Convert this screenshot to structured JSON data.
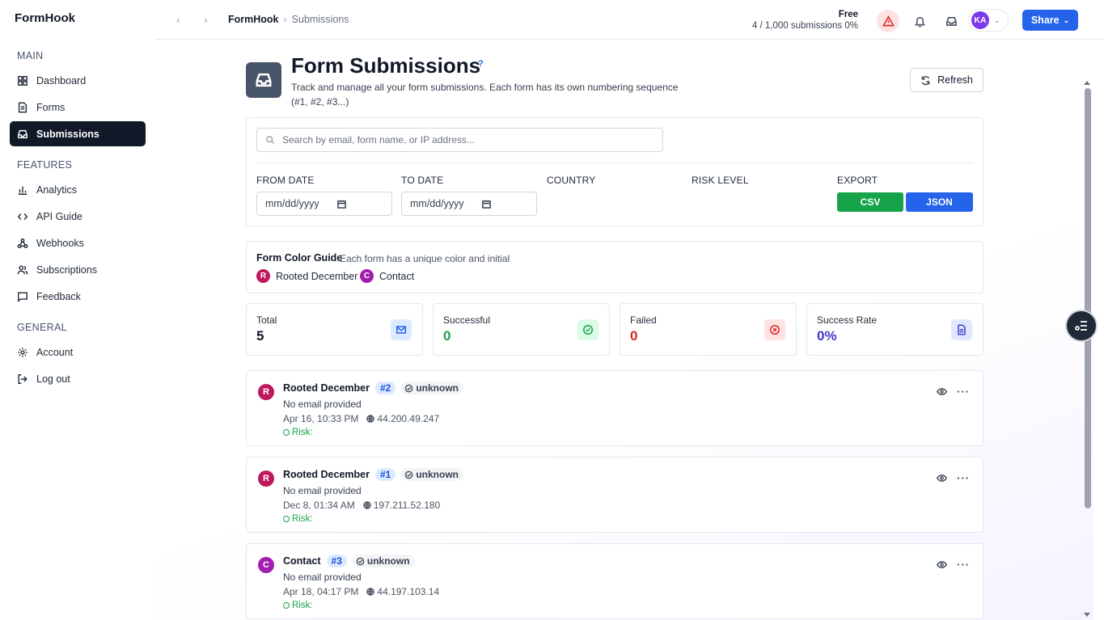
{
  "app": {
    "brand": "FormHook"
  },
  "sidebar": {
    "sections": [
      {
        "label": "MAIN"
      },
      {
        "label": "FEATURES"
      },
      {
        "label": "GENERAL"
      }
    ],
    "items": [
      {
        "label": "Dashboard",
        "icon": "dashboard-icon"
      },
      {
        "label": "Forms",
        "icon": "file-icon"
      },
      {
        "label": "Submissions",
        "icon": "inbox-icon",
        "active": true
      },
      {
        "label": "Analytics",
        "icon": "bar-chart-icon"
      },
      {
        "label": "API Guide",
        "icon": "code-icon"
      },
      {
        "label": "Webhooks",
        "icon": "webhook-icon"
      },
      {
        "label": "Subscriptions",
        "icon": "users-icon"
      },
      {
        "label": "Feedback",
        "icon": "message-icon"
      },
      {
        "label": "Account",
        "icon": "gear-icon"
      },
      {
        "label": "Log out",
        "icon": "logout-icon"
      }
    ]
  },
  "topbar": {
    "breadcrumb": {
      "root": "FormHook",
      "separator": "›",
      "current": "Submissions"
    },
    "plan": {
      "name": "Free",
      "usage": "4 / 1,000 submissions",
      "percent": "0%"
    },
    "avatar_initials": "KA",
    "share_label": "Share"
  },
  "page": {
    "title": "Form Submissions",
    "help": "?",
    "subtitle": "Track and manage all your form submissions. Each form has its own numbering sequence (#1, #2, #3...)",
    "refresh_label": "Refresh"
  },
  "filters": {
    "search_placeholder": "Search by email, form name, or IP address...",
    "from_label": "FROM DATE",
    "to_label": "TO DATE",
    "country_label": "COUNTRY",
    "risk_label": "RISK LEVEL",
    "export_label": "EXPORT",
    "date_placeholder": "mm/dd/yyyy",
    "csv_label": "CSV",
    "json_label": "JSON"
  },
  "guide": {
    "title": "Form Color Guide",
    "subtitle": "Each form has a unique color and initial",
    "forms": [
      {
        "initial": "R",
        "name": "Rooted December",
        "color": "#be185d"
      },
      {
        "initial": "C",
        "name": "Contact",
        "color": "#a21caf"
      }
    ]
  },
  "stats": [
    {
      "label": "Total",
      "value": "5",
      "color": "#111827",
      "icon": "mail-icon"
    },
    {
      "label": "Successful",
      "value": "0",
      "color": "#16a34a",
      "icon": "check-circle-icon"
    },
    {
      "label": "Failed",
      "value": "0",
      "color": "#dc2626",
      "icon": "x-circle-icon"
    },
    {
      "label": "Success Rate",
      "value": "0%",
      "color": "#4338ca",
      "icon": "document-icon"
    }
  ],
  "submissions": [
    {
      "initial": "R",
      "color": "#be185d",
      "form": "Rooted December",
      "number": "#2",
      "status": "unknown",
      "email": "No email provided",
      "date": "Apr 16, 10:33 PM",
      "ip": "44.200.49.247",
      "risk": "Risk:"
    },
    {
      "initial": "R",
      "color": "#be185d",
      "form": "Rooted December",
      "number": "#1",
      "status": "unknown",
      "email": "No email provided",
      "date": "Dec 8, 01:34 AM",
      "ip": "197.211.52.180",
      "risk": "Risk:"
    },
    {
      "initial": "C",
      "color": "#a21caf",
      "form": "Contact",
      "number": "#3",
      "status": "unknown",
      "email": "No email provided",
      "date": "Apr 18, 04:17 PM",
      "ip": "44.197.103.14",
      "risk": "Risk:"
    }
  ],
  "colors": {
    "primary": "#2563eb",
    "csv": "#16a34a",
    "json": "#2563eb",
    "sidebar_active": "#111827"
  }
}
